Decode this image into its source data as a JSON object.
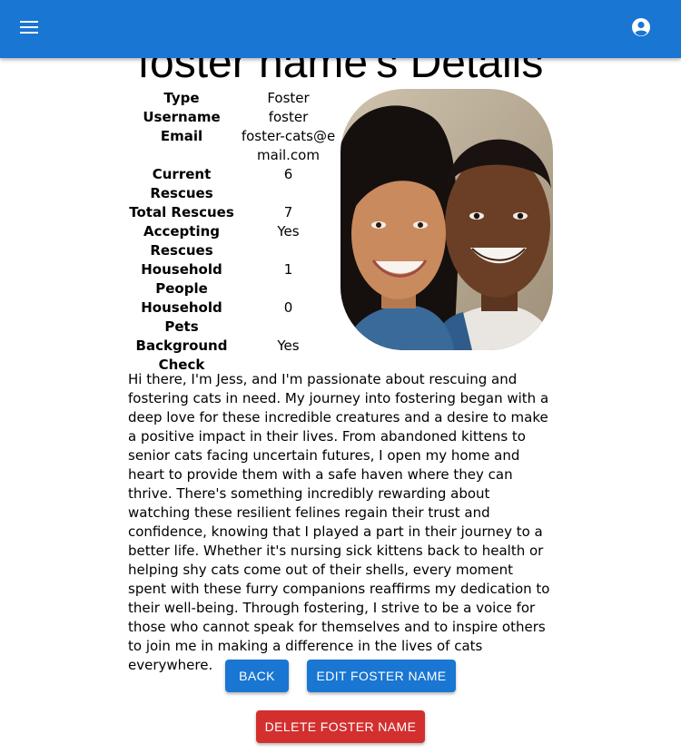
{
  "header": {
    "menu_icon": "menu-icon",
    "account_icon": "account-circle-icon",
    "bar_color": "#1976d2"
  },
  "page": {
    "title": "foster name's Details"
  },
  "details": [
    {
      "label": "Type",
      "value": "Foster"
    },
    {
      "label": "Username",
      "value": "foster"
    },
    {
      "label": "Email",
      "value": "foster-cats@email.com"
    },
    {
      "label": "Current Rescues",
      "value": "6"
    },
    {
      "label": "Total Rescues",
      "value": "7"
    },
    {
      "label": "Accepting Rescues",
      "value": "Yes"
    },
    {
      "label": "Household People",
      "value": "1"
    },
    {
      "label": "Household Pets",
      "value": "0"
    },
    {
      "label": "Background Check",
      "value": "Yes"
    }
  ],
  "bio": "Hi there, I'm Jess, and I'm passionate about rescuing and fostering cats in need. My journey into fostering began with a deep love for these incredible creatures and a desire to make a positive impact in their lives. From abandoned kittens to senior cats facing uncertain futures, I open my home and heart to provide them with a safe haven where they can thrive. There's something incredibly rewarding about watching these resilient felines regain their trust and confidence, knowing that I played a part in their journey to a better life. Whether it's nursing sick kittens back to health or helping shy cats come out of their shells, every moment spent with these furry companions reaffirms my dedication to their well-being. Through fostering, I strive to be a voice for those who cannot speak for themselves and to inspire others to join me in making a difference in the lives of cats everywhere.",
  "actions": {
    "back_label": "Back",
    "edit_label": "Edit foster name",
    "delete_label": "Delete foster name",
    "primary_color": "#1976d2",
    "danger_color": "#d32f2f"
  }
}
